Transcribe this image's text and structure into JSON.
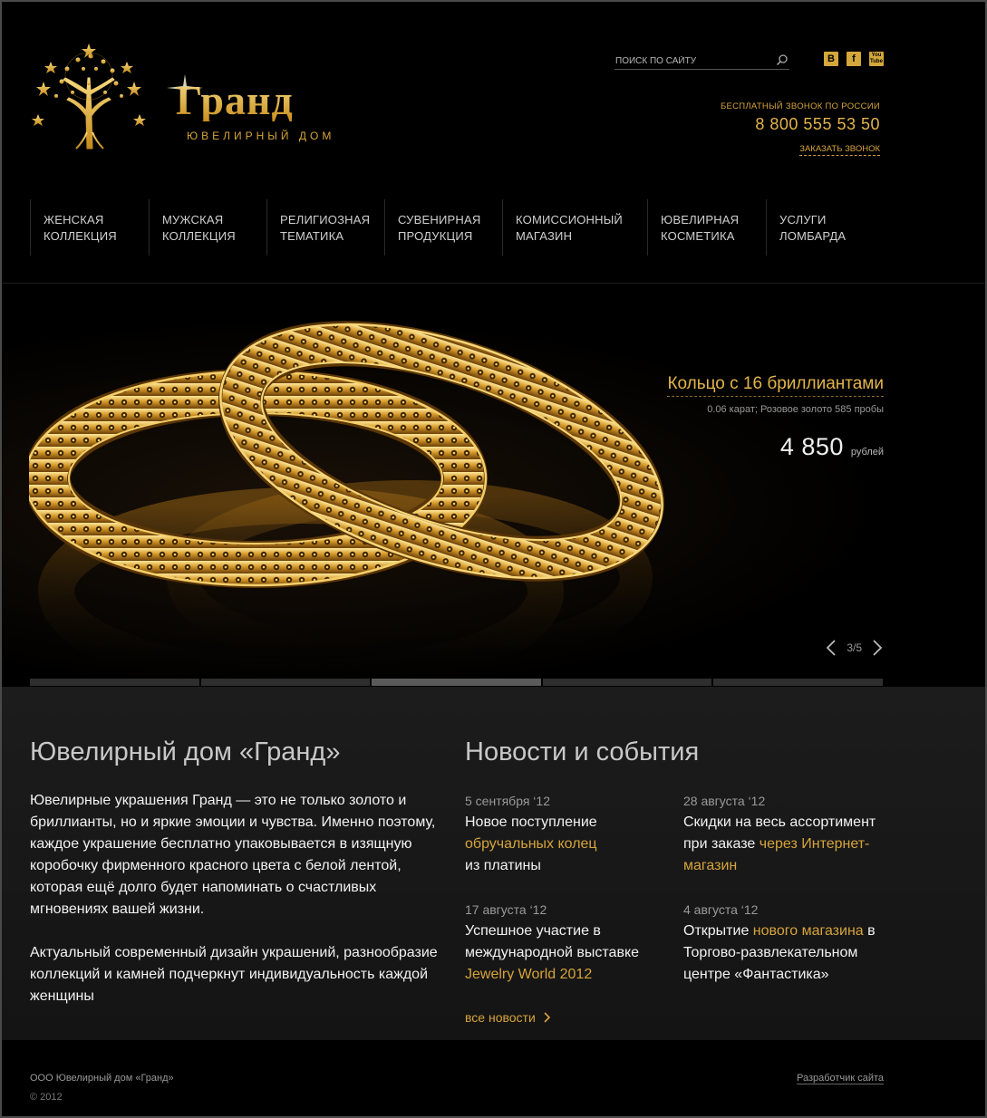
{
  "header": {
    "logo_title": "Гранд",
    "logo_subtitle": "ЮВЕЛИРНЫЙ ДОМ",
    "search_placeholder": "поиск по сайту",
    "socials": [
      "В",
      "f",
      "You Tube"
    ],
    "call_free_label": "бесплатный звонок по России",
    "phone": "8 800 555 53 50",
    "order_call": "заказать звонок"
  },
  "nav": {
    "items": [
      {
        "line1": "Женская",
        "line2": "коллекция"
      },
      {
        "line1": "Мужская",
        "line2": "коллекция"
      },
      {
        "line1": "Религиозная",
        "line2": "тематика"
      },
      {
        "line1": "Сувенирная",
        "line2": "продукция"
      },
      {
        "line1": "Комиссионный",
        "line2": "магазин"
      },
      {
        "line1": "Ювелирная",
        "line2": "косметика"
      },
      {
        "line1": "Услуги",
        "line2": "ломбарда"
      }
    ]
  },
  "slider": {
    "title": "Кольцо с 16 бриллиантами",
    "description": "0.06 карат; Розовое золото 585 пробы",
    "price": "4 850",
    "currency": "рублей",
    "counter": "3/5",
    "active_slide": 3,
    "total_slides": 5
  },
  "about": {
    "heading": "Ювелирный дом «Гранд»",
    "p1": "Ювелирные украшения Гранд — это не только золото и бриллианты, но и яркие эмоции и чувства. Именно поэтому, каждое украшение бесплатно упаковывается в изящную коробочку фирменного красного цвета с белой лентой, которая ещё долго будет напоминать о счастливых мгновениях вашей жизни.",
    "p2": "Актуальный современный дизайн украшений, разнообразие коллекций и камней подчеркнут индивидуальность каждой женщины"
  },
  "news": {
    "heading": "Новости и события",
    "items": [
      {
        "date": "5 сентября ‘12",
        "pre": "Новое поступление",
        "link": "обручальных колец",
        "post": "из платины"
      },
      {
        "date": "28 августа ‘12",
        "pre": "Скидки на весь ассортимент при заказе",
        "link": "через Интернет-магазин",
        "post": ""
      },
      {
        "date": "17 августа ‘12",
        "pre": "Успешное участие в международной выставке",
        "link": "Jewelry World 2012",
        "post": ""
      },
      {
        "date": "4 августа ‘12",
        "pre": "Открытие",
        "link": "нового магазина",
        "post": "в Торгово-развлекательном центре «Фантастика»"
      }
    ],
    "all_label": "все новости"
  },
  "footer": {
    "company": "ООО Ювелирный дом «Гранд»",
    "copyright": "© 2012",
    "developer": "Разработчик сайта"
  },
  "colors": {
    "gold": "#d6a43b",
    "background": "#000000",
    "content_bg": "#1a1a1a"
  }
}
